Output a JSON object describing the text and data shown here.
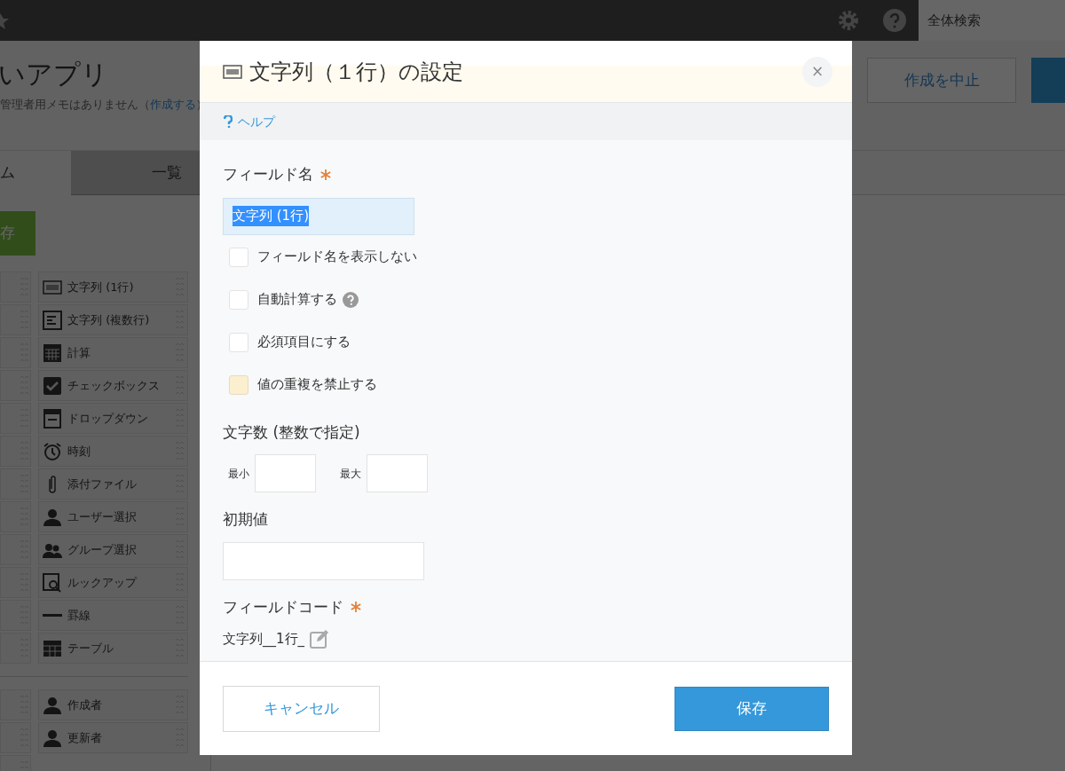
{
  "top_bar": {
    "search": {
      "placeholder": "全体検索"
    }
  },
  "app": {
    "title": "いアプリ",
    "memo_before": "管理者用メモはありません（",
    "memo_link": "作成する",
    "memo_after": "）"
  },
  "header_buttons": [
    {
      "label": "作成を中止",
      "kind": "outline"
    },
    {
      "kind": "primary"
    }
  ],
  "tabs": [
    {
      "label": "ム",
      "selected": true
    },
    {
      "label": "一覧",
      "selected": false
    }
  ],
  "save_button": {
    "label": "存"
  },
  "palette": [
    {
      "kind": "abc",
      "label": "文字列 (1行)"
    },
    {
      "kind": "lines",
      "label": "文字列 (複数行)"
    },
    {
      "kind": "calc",
      "label": "計算"
    },
    {
      "kind": "check",
      "label": "チェックボックス"
    },
    {
      "kind": "dropdown",
      "label": "ドロップダウン"
    },
    {
      "kind": "clock",
      "label": "時刻"
    },
    {
      "kind": "clip",
      "label": "添付ファイル"
    },
    {
      "kind": "user",
      "label": "ユーザー選択"
    },
    {
      "kind": "group",
      "label": "グループ選択"
    },
    {
      "kind": "lookup",
      "label": "ルックアップ"
    },
    {
      "kind": "rule",
      "label": "罫線"
    },
    {
      "kind": "table",
      "label": "テーブル"
    },
    {
      "kind": "divider"
    },
    {
      "kind": "user",
      "label": "作成者"
    },
    {
      "kind": "user",
      "label": "更新者"
    },
    {
      "kind": "empty"
    }
  ],
  "dialog": {
    "title": "文字列（１行）の設定",
    "close": "×",
    "help": "ヘルプ",
    "field_name": {
      "label": "フィールド名",
      "required": true,
      "value": "文字列 (1行)",
      "text_selected": true
    },
    "options": [
      {
        "label": "フィールド名を表示しない",
        "checked": false,
        "hovered": false,
        "help": false
      },
      {
        "label": "自動計算する",
        "checked": false,
        "hovered": false,
        "help": true
      },
      {
        "label": "必須項目にする",
        "checked": false,
        "hovered": false,
        "help": false
      },
      {
        "label": "値の重複を禁止する",
        "checked": false,
        "hovered": true,
        "help": false
      }
    ],
    "length": {
      "label": "文字数 (整数で指定)",
      "min_label": "最小",
      "max_label": "最大"
    },
    "default_value": {
      "label": "初期値"
    },
    "field_code": {
      "label": "フィールドコード",
      "required": true,
      "value": "文字列__1行_"
    },
    "buttons": [
      {
        "label": "キャンセル",
        "kind": "cancel"
      },
      {
        "label": "保存",
        "kind": "save"
      }
    ]
  }
}
